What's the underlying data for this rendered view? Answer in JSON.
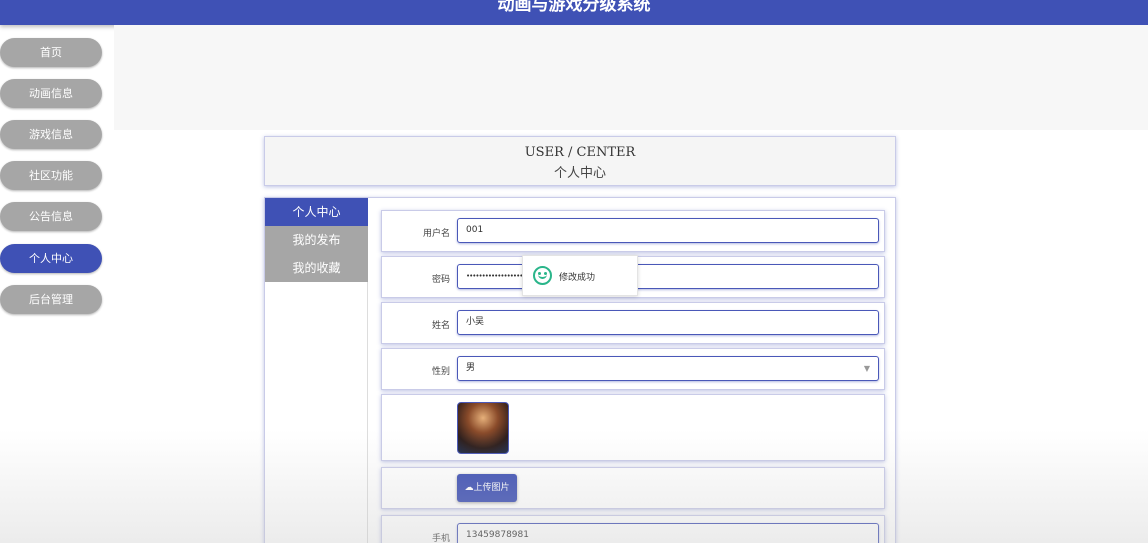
{
  "header": {
    "title": "动画与游戏分级系统"
  },
  "sidebar": {
    "items": [
      {
        "label": "首页",
        "active": false
      },
      {
        "label": "动画信息",
        "active": false
      },
      {
        "label": "游戏信息",
        "active": false
      },
      {
        "label": "社区功能",
        "active": false
      },
      {
        "label": "公告信息",
        "active": false
      },
      {
        "label": "个人中心",
        "active": true
      },
      {
        "label": "后台管理",
        "active": false
      }
    ]
  },
  "user_center": {
    "title_en": "USER / CENTER",
    "title_cn": "个人中心"
  },
  "tabs": [
    {
      "label": "个人中心",
      "active": true
    },
    {
      "label": "我的发布",
      "active": false
    },
    {
      "label": "我的收藏",
      "active": false
    }
  ],
  "form": {
    "username": {
      "label": "用户名",
      "value": "001"
    },
    "password": {
      "label": "密码",
      "value": "••••••••••••••••••••"
    },
    "name": {
      "label": "姓名",
      "value": "小吴"
    },
    "gender": {
      "label": "性别",
      "value": "男"
    },
    "upload_label": "上传图片",
    "phone": {
      "label": "手机",
      "value": "13459878981"
    }
  },
  "toast": {
    "message": "修改成功",
    "icon": "smile-icon"
  },
  "colors": {
    "primary": "#3f51b5",
    "inactive": "#a6a6a6",
    "success": "#2ab58a"
  }
}
